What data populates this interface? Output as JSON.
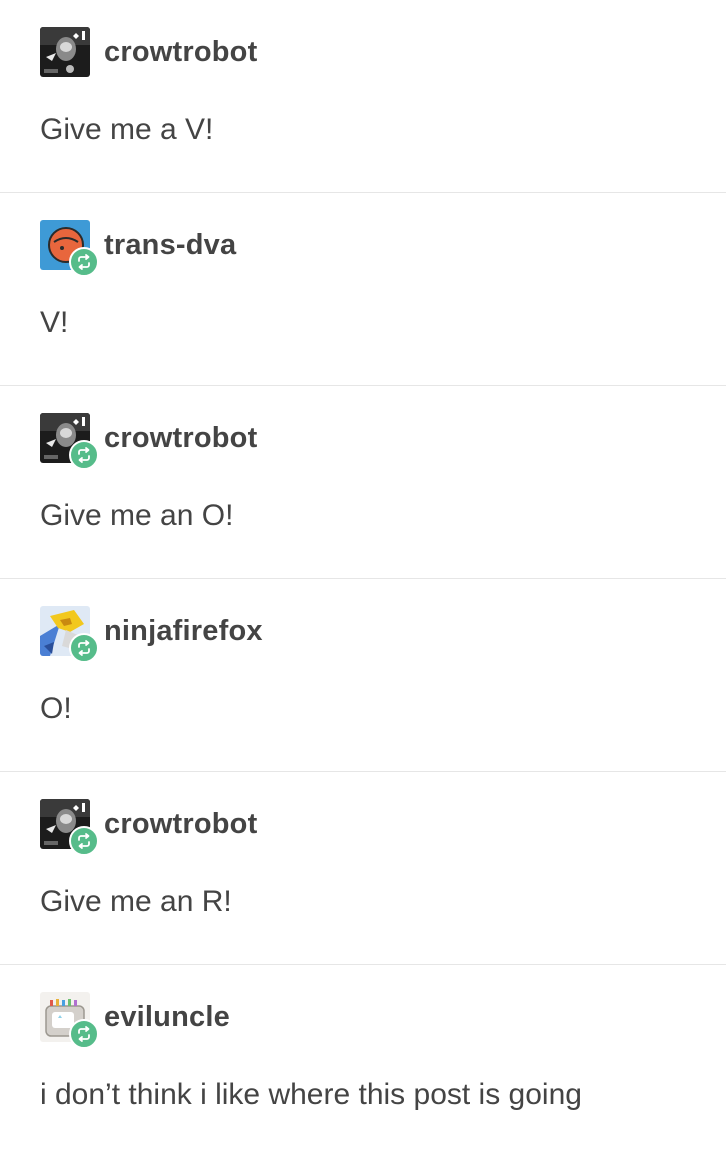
{
  "posts": [
    {
      "username": "crowtrobot",
      "text": "Give me a V!",
      "avatar_icon": "dark-robot-avatar-icon",
      "reblogged": false
    },
    {
      "username": "trans-dva",
      "text": "V!",
      "avatar_icon": "orange-circle-avatar-icon",
      "reblogged": true
    },
    {
      "username": "crowtrobot",
      "text": "Give me an O!",
      "avatar_icon": "dark-robot-avatar-icon",
      "reblogged": true
    },
    {
      "username": "ninjafirefox",
      "text": "O!",
      "avatar_icon": "yellow-character-avatar-icon",
      "reblogged": true
    },
    {
      "username": "crowtrobot",
      "text": "Give me an R!",
      "avatar_icon": "dark-robot-avatar-icon",
      "reblogged": true
    },
    {
      "username": "eviluncle",
      "text": "i don’t think i like where this post is going",
      "avatar_icon": "toaster-avatar-icon",
      "reblogged": true
    }
  ],
  "colors": {
    "text": "#444444",
    "reblog_green": "#56bc8a",
    "divider": "#e6e6e6"
  },
  "reblog_icon": "reblog-icon"
}
